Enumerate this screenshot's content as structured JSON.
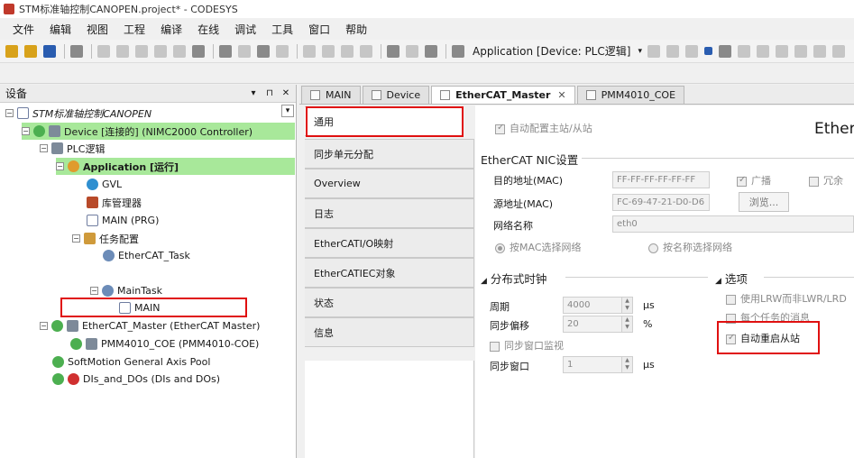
{
  "window": {
    "title": "STM标准轴控制CANOPEN.project* - CODESYS"
  },
  "menu": [
    "文件",
    "编辑",
    "视图",
    "工程",
    "编译",
    "在线",
    "调试",
    "工具",
    "窗口",
    "帮助"
  ],
  "toolbar": {
    "application_selector": "Application [Device: PLC逻辑]"
  },
  "devices_pane": {
    "title": "设备",
    "pin_label": "▾",
    "dock_label": "⊓",
    "close_label": "✕",
    "tree": {
      "project": "STM标准轴控制CANOPEN",
      "device": "Device [连接的] (NIMC2000 Controller)",
      "plc_logic": "PLC逻辑",
      "application": "Application [运行]",
      "gvl": "GVL",
      "library_manager": "库管理器",
      "main_prg": "MAIN (PRG)",
      "task_config": "任务配置",
      "ethercat_task": "EtherCAT_Task",
      "main_task": "MainTask",
      "main": "MAIN",
      "ethercat_master": "EtherCAT_Master (EtherCAT Master)",
      "pmm_coe": "PMM4010_COE (PMM4010-COE)",
      "softmotion_pool": "SoftMotion General Axis Pool",
      "dis_dos": "DIs_and_DOs (DIs and DOs)"
    }
  },
  "editor_tabs": [
    {
      "label": "MAIN"
    },
    {
      "label": "Device"
    },
    {
      "label": "EtherCAT_Master",
      "active": true
    },
    {
      "label": "PMM4010_COE"
    }
  ],
  "side_tabs": [
    "通用",
    "同步单元分配",
    "Overview",
    "日志",
    "EtherCATI/O映射",
    "EtherCATIEC对象",
    "状态",
    "信息"
  ],
  "general": {
    "auto_config_label": "自动配置主站/从站",
    "brand_label": "EtherC",
    "nic_section": "EtherCAT NIC设置",
    "dest_mac_label": "目的地址(MAC)",
    "dest_mac_value": "FF-FF-FF-FF-FF-FF",
    "broadcast_label": "广播",
    "redundancy_label": "冗余",
    "src_mac_label": "源地址(MAC)",
    "src_mac_value": "FC-69-47-21-D0-D6",
    "browse_label": "浏览...",
    "netname_label": "网络名称",
    "netname_value": "eth0",
    "select_by_mac": "按MAC选择网络",
    "select_by_name": "按名称选择网络",
    "dist_clock_section": "分布式时钟",
    "cycle_label": "周期",
    "cycle_value": "4000",
    "cycle_unit": "μs",
    "sync_offset_label": "同步偏移",
    "sync_offset_value": "20",
    "sync_offset_unit": "%",
    "sync_window_monitor": "同步窗口监视",
    "sync_window_label": "同步窗口",
    "sync_window_value": "1",
    "sync_window_unit": "μs",
    "options_section": "选项",
    "use_lrw": "使用LRW而非LWR/LRD",
    "msg_per_task": "每个任务的消息",
    "auto_restart": "自动重启从站"
  }
}
